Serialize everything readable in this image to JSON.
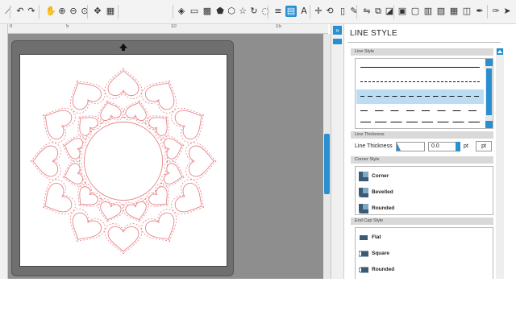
{
  "toolbar": {
    "icons": [
      "knife-icon",
      "undo-icon",
      "redo-icon",
      "pan-hand-icon",
      "zoom-in-icon",
      "zoom-out-icon",
      "zoom-fit-icon",
      "move-icon",
      "grid-icon",
      "eraser-icon",
      "fill-icon",
      "pattern-icon",
      "pentagon-icon",
      "hexagon-icon",
      "star-icon",
      "spiral-icon",
      "shape-icon",
      "line-color-icon",
      "line-style-icon",
      "text-icon",
      "crosshair-icon",
      "rotate-icon",
      "page-icon",
      "pen-icon",
      "mirror-icon",
      "link-icon",
      "trace-icon",
      "image-icon",
      "offset-icon",
      "replicate-icon",
      "layers-icon",
      "grid-view-icon",
      "library-icon",
      "sketch-icon",
      "pen-tool-icon",
      "send-icon"
    ]
  },
  "ruler": {
    "marks": [
      "0",
      "5",
      "10",
      "15"
    ]
  },
  "panel": {
    "title": "LINE STYLE",
    "sections": {
      "line_style": "Line Style",
      "line_thickness": "Line Thickness",
      "corner_style": "Corner Style",
      "end_cap_style": "End Cap Style"
    },
    "line_styles": [
      "solid",
      "fine-dashed",
      "dashed",
      "long-dashed",
      "dash-dot"
    ],
    "selected_line_style": "dashed",
    "thickness": {
      "label": "Line Thickness",
      "value": "0.0",
      "unit": "pt",
      "unit_button": "pt"
    },
    "corners": [
      {
        "label": "Corner",
        "icon": "corner-miter-icon"
      },
      {
        "label": "Bevelled",
        "icon": "corner-bevel-icon"
      },
      {
        "label": "Rounded",
        "icon": "corner-round-icon"
      }
    ],
    "end_caps": [
      {
        "label": "Flat",
        "icon": "cap-flat-icon"
      },
      {
        "label": "Square",
        "icon": "cap-square-icon"
      },
      {
        "label": "Rounded",
        "icon": "cap-round-icon"
      }
    ]
  },
  "colors": {
    "accent": "#2a8fd0",
    "cut_line": "#e8848a",
    "mat": "#6f6f6f",
    "workspace": "#8e8e8e"
  }
}
